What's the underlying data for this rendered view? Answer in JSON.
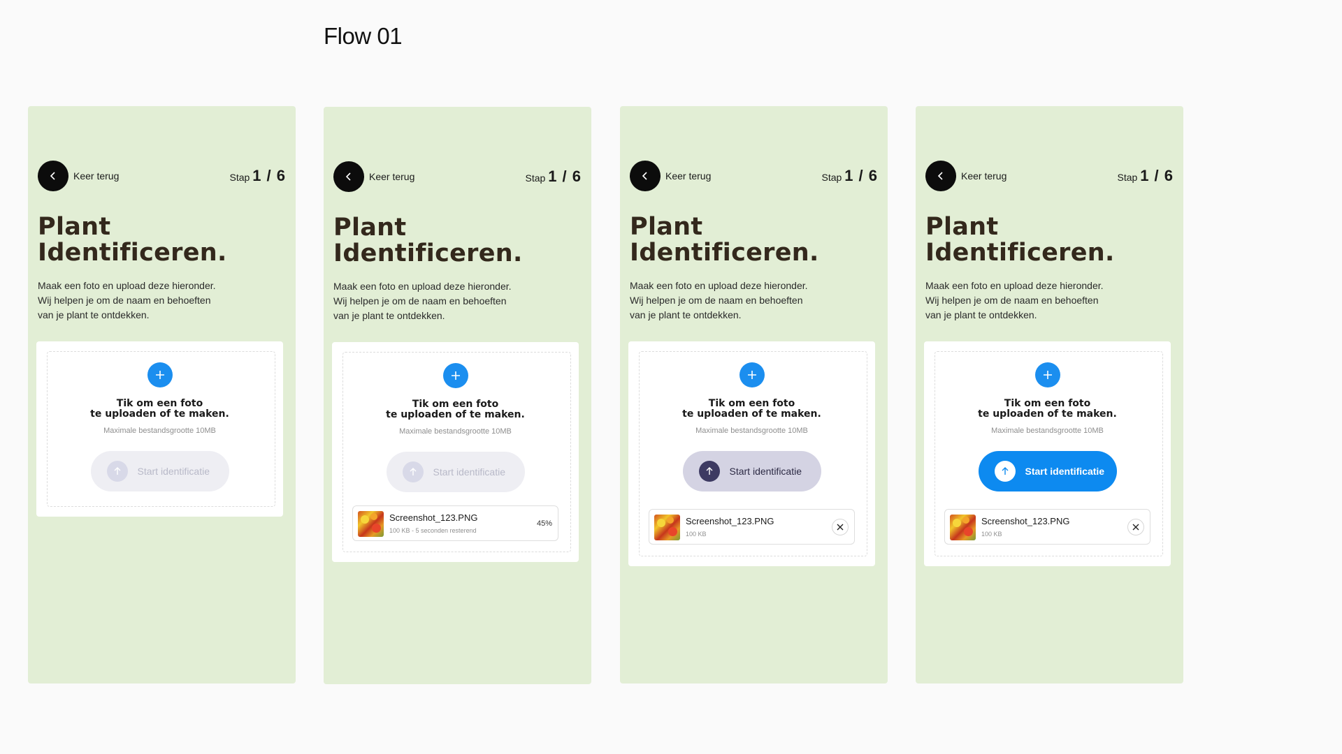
{
  "flow_title": "Flow 01",
  "common": {
    "back_label": "Keer terug",
    "step_prefix": "Stap",
    "step_value": "1 / 6",
    "title_line1": "Plant",
    "title_line2": "Identificeren.",
    "desc_line1": "Maak een foto en upload deze hieronder.",
    "desc_line2": "Wij helpen je om de naam en behoeften",
    "desc_line3": "van je plant te ontdekken.",
    "cta_line1": "Tik om een foto",
    "cta_line2": "te uploaden of te maken.",
    "max_size": "Maximale bestandsgrootte 10MB",
    "start_label": "Start identificatie"
  },
  "screens": [
    {
      "state": "empty",
      "button_state": "disabled"
    },
    {
      "state": "uploading",
      "button_state": "disabled",
      "file": {
        "name": "Screenshot_123.PNG",
        "meta": "100 KB - 5 seconden resterend",
        "progress_label": "45%",
        "progress": 0.45
      }
    },
    {
      "state": "uploaded",
      "button_state": "hover",
      "file": {
        "name": "Screenshot_123.PNG",
        "meta": "100 KB"
      }
    },
    {
      "state": "ready",
      "button_state": "active",
      "file": {
        "name": "Screenshot_123.PNG",
        "meta": "100 KB"
      }
    }
  ],
  "icons": {
    "back": "chevron-left-icon",
    "add": "plus-icon",
    "start": "arrow-up-icon",
    "remove": "close-icon"
  },
  "colors": {
    "screen_bg": "#e2eed5",
    "accent_blue": "#0d8af0",
    "title_brown": "#33281c",
    "hover_button": "#d4d3e3"
  }
}
